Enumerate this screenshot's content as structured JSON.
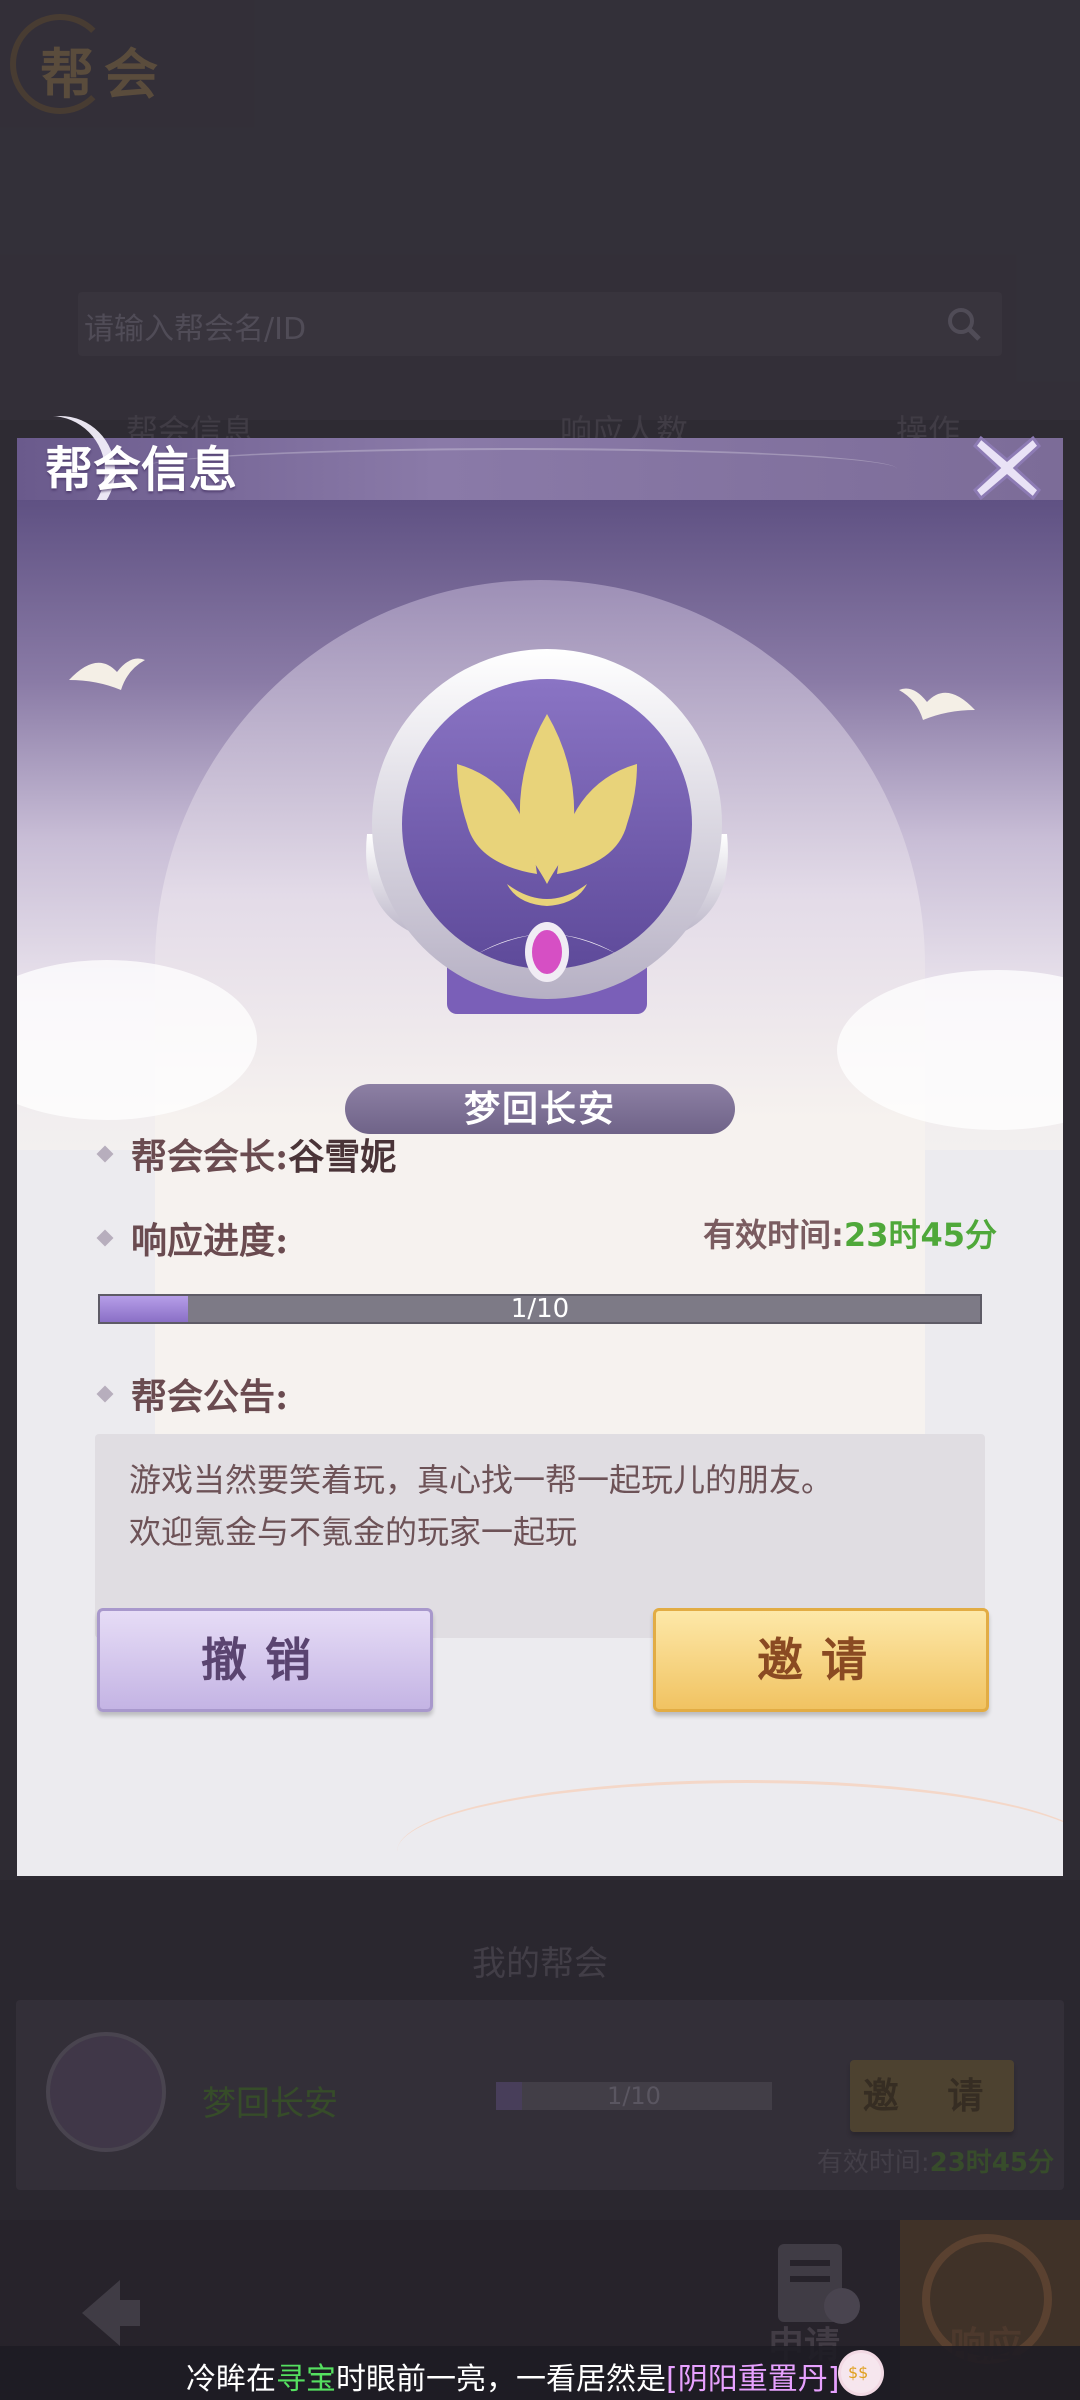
{
  "background": {
    "page_title": "帮会",
    "search_placeholder": "请输入帮会名/ID",
    "columns": [
      "帮会信息",
      "响应人数",
      "操作"
    ],
    "my_guild_title": "我的帮会",
    "my_guild": {
      "name": "梦回长安",
      "progress_text": "1/10",
      "invite_label": "邀 请",
      "valid_time_label": "有效时间:",
      "valid_time_value": "23时45分"
    },
    "bottom_nav": {
      "apply_label": "申请",
      "respond_label": "响应"
    }
  },
  "dialog": {
    "title": "帮会信息",
    "guild_name": "梦回长安",
    "leader_label": "帮会会长:",
    "leader_value": "谷雪妮",
    "progress_label": "响应进度:",
    "valid_time_label": "有效时间:",
    "valid_time_value": "23时45分",
    "progress": {
      "current": 1,
      "total": 10,
      "text": "1/10"
    },
    "notice_label": "帮会公告:",
    "notice_text": "游戏当然要笑着玩，真心找一帮一起玩儿的朋友。\n欢迎氪金与不氪金的玩家一起玩",
    "cancel_label": "撤销",
    "invite_label": "邀请"
  },
  "ticker": {
    "part1": "冷眸在",
    "part2": "寻宝",
    "part3": "时眼前一亮，一看居然是",
    "part4": "[阴阳重置丹]"
  },
  "colors": {
    "accent_purple": "#8a6fc6",
    "accent_gold": "#f1c362",
    "time_green": "#4fa83a"
  },
  "icons": [
    "search-icon",
    "close-icon",
    "back-arrow-icon",
    "apply-icon",
    "respond-icon",
    "lotus-emblem-icon",
    "money-face-emoji-icon"
  ]
}
